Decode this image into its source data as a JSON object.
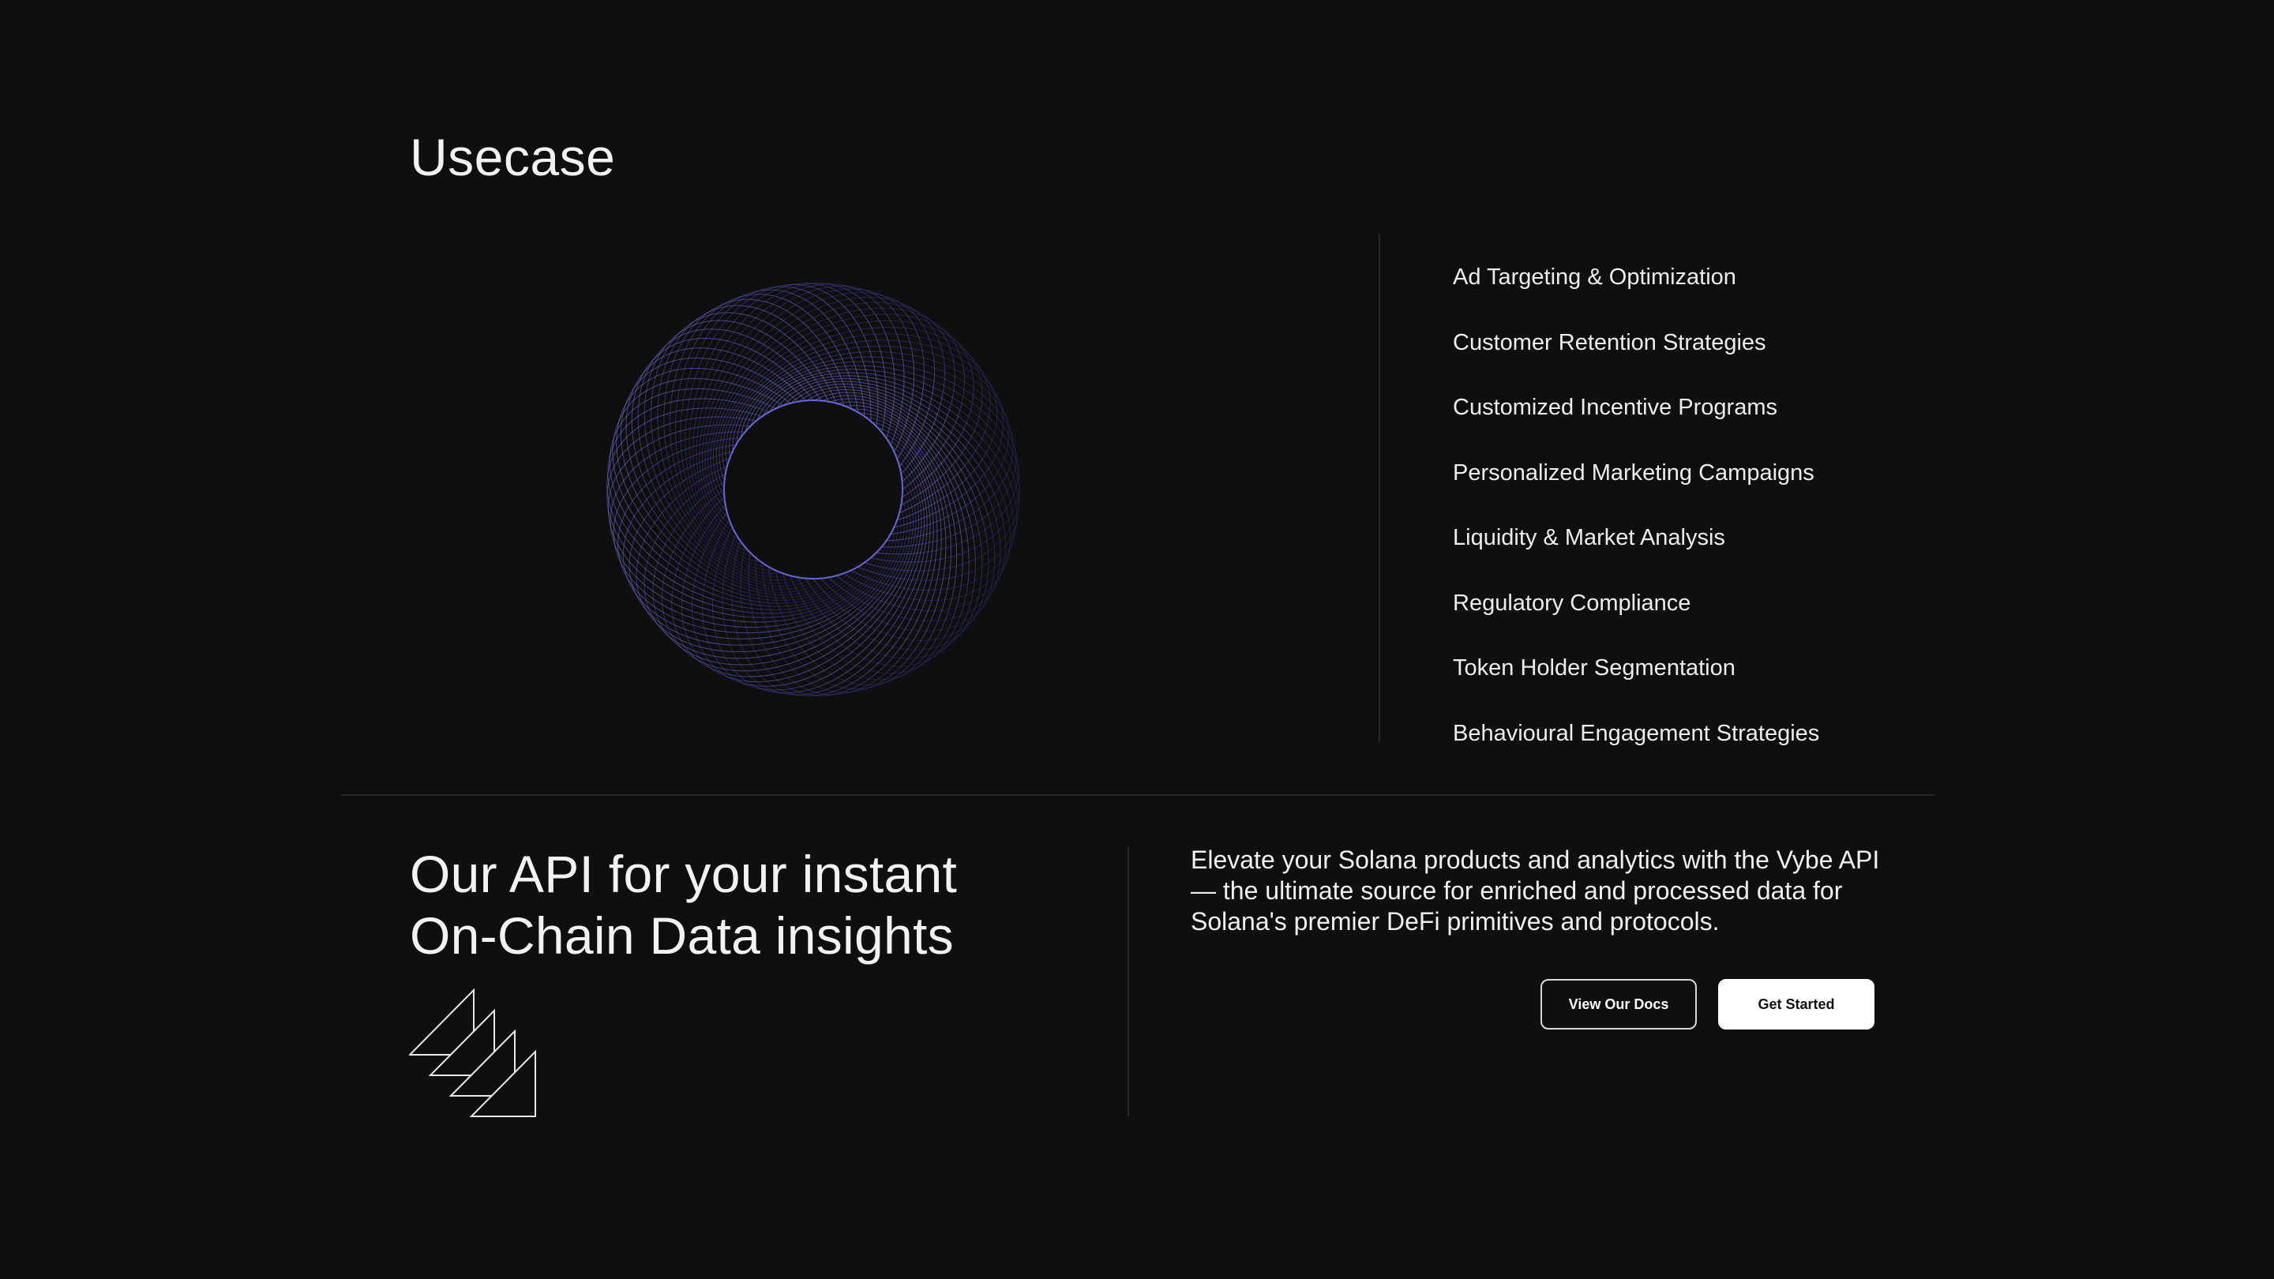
{
  "usecase": {
    "title": "Usecase",
    "items": [
      "Ad Targeting & Optimization",
      "Customer Retention Strategies",
      "Customized Incentive Programs",
      "Personalized Marketing Campaigns",
      "Liquidity & Market Analysis",
      "Regulatory Compliance",
      "Token Holder Segmentation",
      "Behavioural Engagement Strategies"
    ]
  },
  "api": {
    "title_line1": "Our API for your instant",
    "title_line2": "On-Chain Data insights",
    "description": "Elevate your Solana products and analytics with the Vybe API — the ultimate source for enriched and processed data for Solana's premier DeFi primitives and protocols.",
    "docs_button": "View Our Docs",
    "start_button": "Get Started"
  },
  "colors": {
    "background": "#0f0f10",
    "spiral_accent": "#6a63ff",
    "text": "#f2f2f2"
  },
  "icons": {
    "spiral": "spirograph-graphic",
    "triangles": "stacked-triangles-icon"
  }
}
